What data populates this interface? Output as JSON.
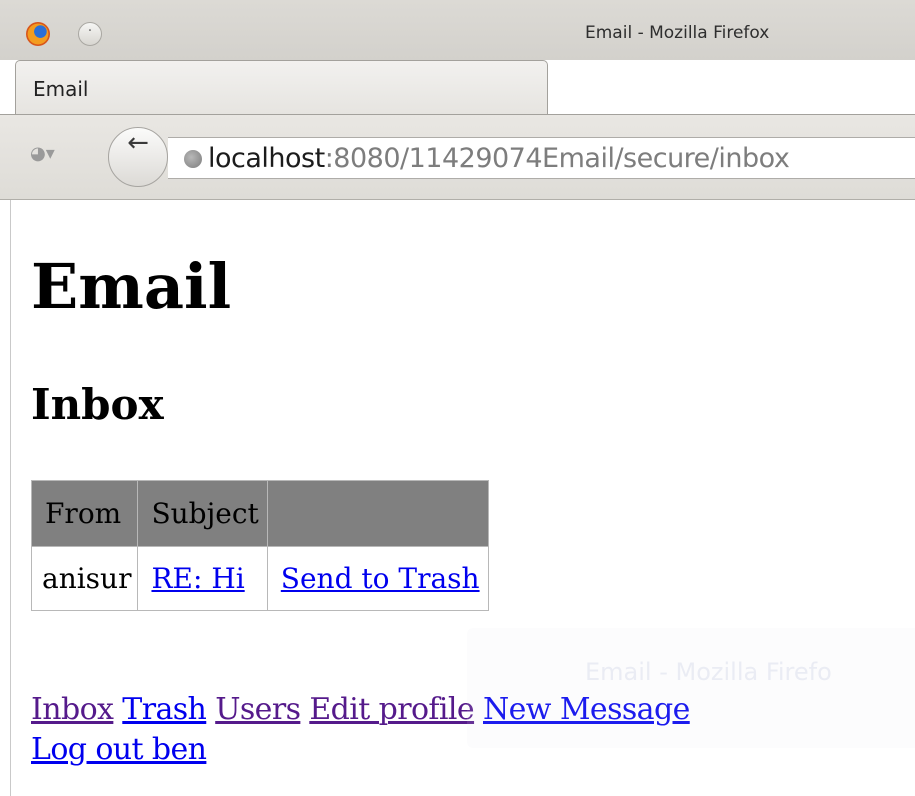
{
  "window": {
    "title": "Email - Mozilla Firefox"
  },
  "browser": {
    "tab_label": "Email",
    "url_host": "localhost",
    "url_rest": ":8080/11429074Email/secure/inbox"
  },
  "page": {
    "title": "Email",
    "section_title": "Inbox"
  },
  "table": {
    "headers": [
      "From",
      "Subject",
      ""
    ],
    "rows": [
      {
        "from": "anisur",
        "subject": "RE: Hi",
        "action": "Send to Trash"
      }
    ]
  },
  "nav": {
    "inbox": "Inbox",
    "trash": "Trash",
    "users": "Users",
    "edit_profile": "Edit profile",
    "new_message": "New Message",
    "logout": "Log out ben"
  },
  "notification": {
    "ghost_text": "Email - Mozilla Firefo"
  },
  "colors": {
    "link": "#0000ee",
    "visited_link": "#551a8b",
    "table_header_bg": "#808080"
  }
}
